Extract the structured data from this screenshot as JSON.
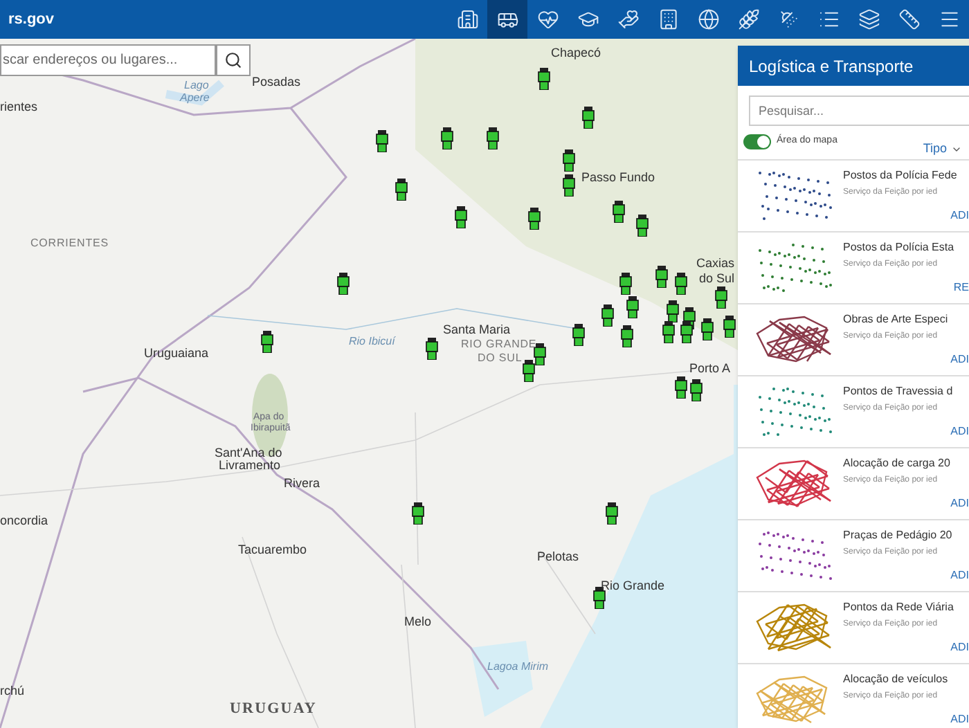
{
  "header": {
    "title": "rs.gov"
  },
  "toolbar": {
    "tools": [
      {
        "selected": false
      },
      {
        "selected": true
      },
      {
        "selected": false
      },
      {
        "selected": false
      },
      {
        "selected": false
      },
      {
        "selected": false
      },
      {
        "selected": false
      },
      {
        "selected": false
      },
      {
        "selected": false
      },
      {
        "selected": false
      },
      {
        "selected": false
      },
      {
        "selected": false
      },
      {
        "selected": false
      }
    ]
  },
  "search": {
    "placeholder": "scar endereços ou lugares..."
  },
  "map": {
    "labels": [
      {
        "text": "Chapecó",
        "kind": "city"
      },
      {
        "text": "Posadas",
        "kind": "city"
      },
      {
        "text": "Lago",
        "kind": "water"
      },
      {
        "text": "Apere",
        "kind": "water"
      },
      {
        "text": "rientes",
        "kind": "city"
      },
      {
        "text": "CORRIENTES",
        "kind": "region"
      },
      {
        "text": "Uruguaiana",
        "kind": "city"
      },
      {
        "text": "Rio Ibicuí",
        "kind": "water"
      },
      {
        "text": "Passo Fundo",
        "kind": "city"
      },
      {
        "text": "Caxias",
        "kind": "city"
      },
      {
        "text": "do Sul",
        "kind": "city"
      },
      {
        "text": "Santa Maria",
        "kind": "city"
      },
      {
        "text": "RIO GRANDE",
        "kind": "region"
      },
      {
        "text": "DO SUL",
        "kind": "region"
      },
      {
        "text": "Porto A",
        "kind": "city"
      },
      {
        "text": "Apa do",
        "kind": "park"
      },
      {
        "text": "Ibirapuitã",
        "kind": "park"
      },
      {
        "text": "Sant'Ana do",
        "kind": "city"
      },
      {
        "text": "Livramento",
        "kind": "city"
      },
      {
        "text": "Rivera",
        "kind": "city"
      },
      {
        "text": "oncordia",
        "kind": "city"
      },
      {
        "text": "Tacuarembo",
        "kind": "city"
      },
      {
        "text": "Pelotas",
        "kind": "city"
      },
      {
        "text": "Rio Grande",
        "kind": "city"
      },
      {
        "text": "Melo",
        "kind": "city"
      },
      {
        "text": "Lagoa Mirim",
        "kind": "water"
      },
      {
        "text": "URUGUAY",
        "kind": "country"
      },
      {
        "text": "rchú",
        "kind": "city"
      }
    ]
  },
  "panel": {
    "title": "Logística e Transporte",
    "search": {
      "placeholder": "Pesquisar..."
    },
    "map_area": {
      "label": "Área do mapa",
      "on": true
    },
    "sort": {
      "label": "Tipo"
    },
    "items": [
      {
        "title": "Postos da Polícia Fede",
        "subtitle": "Serviço da Feição por ied",
        "action": "ADI",
        "kind": "points",
        "color": "#2d4a8a"
      },
      {
        "title": "Postos da Polícia Esta",
        "subtitle": "Serviço da Feição por ied",
        "action": "RE",
        "kind": "points",
        "color": "#2e7d32"
      },
      {
        "title": "Obras de Arte Especi",
        "subtitle": "Serviço da Feição por ied",
        "action": "ADI",
        "kind": "network",
        "color": "#8a3a4a"
      },
      {
        "title": "Pontos de Travessia d",
        "subtitle": "Serviço da Feição por ied",
        "action": "ADI",
        "kind": "points",
        "color": "#1f8a78"
      },
      {
        "title": "Alocação de carga 20",
        "subtitle": "Serviço da Feição por ied",
        "action": "ADI",
        "kind": "network",
        "color": "#d2364a"
      },
      {
        "title": "Praças de Pedágio 20",
        "subtitle": "Serviço da Feição por ied",
        "action": "ADI",
        "kind": "points",
        "color": "#8a3aa0"
      },
      {
        "title": "Pontos da Rede Viária",
        "subtitle": "Serviço da Feição por ied",
        "action": "ADI",
        "kind": "network",
        "color": "#b8860b"
      },
      {
        "title": "Alocação de veículos",
        "subtitle": "Serviço da Feição por ied",
        "action": "ADI",
        "kind": "network",
        "color": "#e0b050"
      }
    ]
  }
}
